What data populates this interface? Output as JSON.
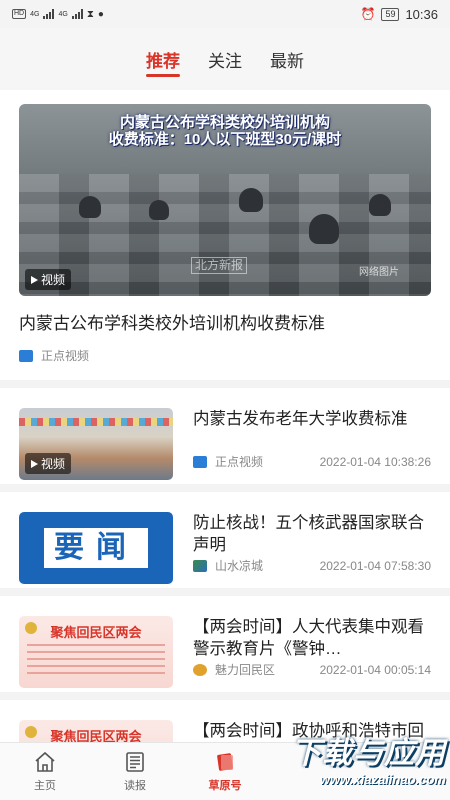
{
  "status_bar": {
    "left_badges": [
      "HD",
      "HD"
    ],
    "net_labels": [
      "4G",
      "4G"
    ],
    "battery": "59",
    "time": "10:36"
  },
  "tabs": [
    {
      "label": "推荐",
      "active": true
    },
    {
      "label": "关注",
      "active": false
    },
    {
      "label": "最新",
      "active": false
    }
  ],
  "featured": {
    "thumb_caption_line1": "内蒙古公布学科类校外培训机构",
    "thumb_caption_line2": "收费标准：10人以下班型30元/课时",
    "thumb_watermark": "网络图片",
    "thumb_logo": "北方新报",
    "video_label": "视频",
    "title": "内蒙古公布学科类校外培训机构收费标准",
    "source": "正点视频"
  },
  "items": [
    {
      "title": "内蒙古发布老年大学收费标准",
      "source": "正点视频",
      "time": "2022-01-04 10:38:26",
      "thumb": "hall",
      "video_label": "视频"
    },
    {
      "title": "防止核战！五个核武器国家联合声明",
      "source": "山水凉城",
      "time": "2022-01-04 07:58:30",
      "thumb": "yaowen",
      "thumb_text": "要闻"
    },
    {
      "title": "【两会时间】人大代表集中观看警示教育片《警钟…",
      "source": "魅力回民区",
      "time": "2022-01-04 00:05:14",
      "thumb": "lianghui",
      "thumb_text": "聚焦回民区两会"
    },
    {
      "title": "【两会时间】政协呼和浩特市回民区第十届委员会…",
      "thumb": "lianghui",
      "thumb_text": "聚焦回民区两会"
    }
  ],
  "bottom_nav": [
    {
      "label": "主页",
      "icon": "home-icon",
      "active": false
    },
    {
      "label": "读报",
      "icon": "newspaper-icon",
      "active": false
    },
    {
      "label": "草原号",
      "icon": "grassland-icon",
      "active": true
    }
  ],
  "overlay": {
    "brand": "下载与应用",
    "url": "www.xiazaiinao.com"
  },
  "colors": {
    "accent": "#d8352a",
    "text": "#222222",
    "meta": "#888888"
  }
}
